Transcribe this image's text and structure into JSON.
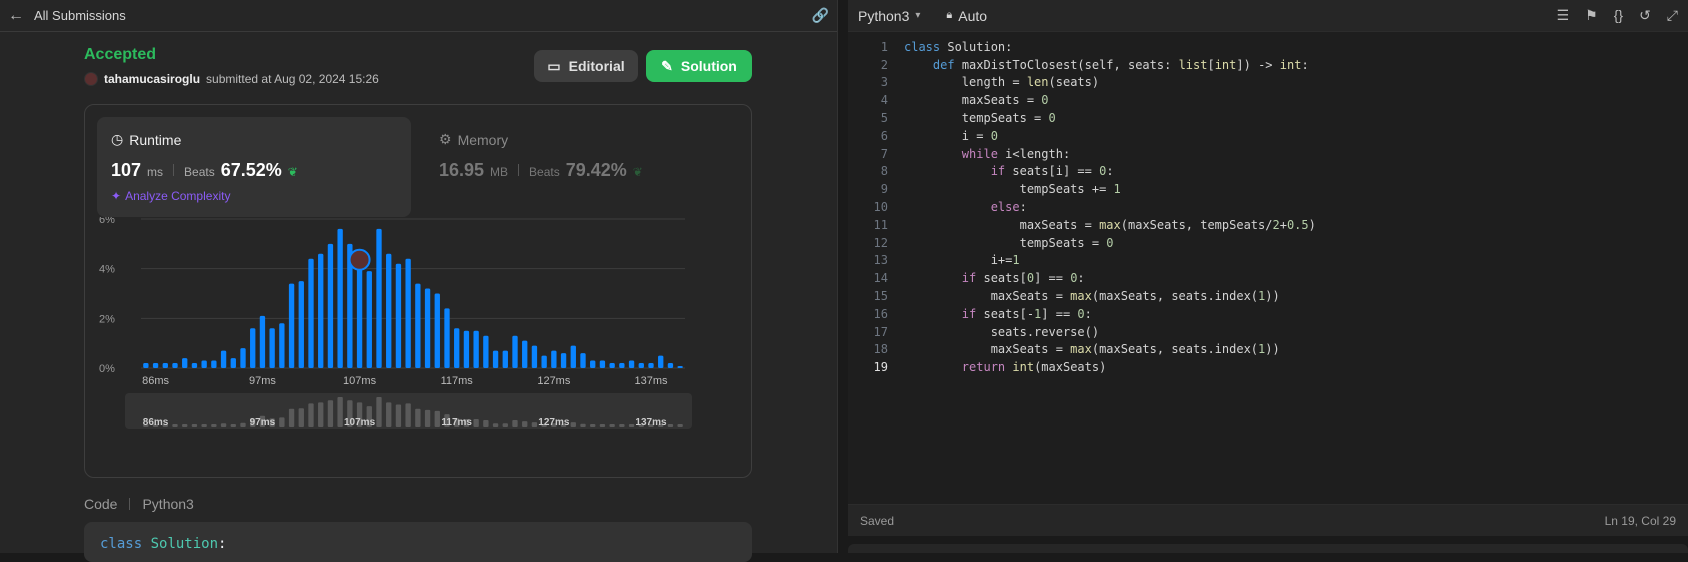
{
  "header": {
    "back_label": "All Submissions"
  },
  "submission": {
    "status": "Accepted",
    "user": "tahamucasiroglu",
    "submitted_text": "submitted at Aug 02, 2024 15:26",
    "editorial_label": "Editorial",
    "solution_label": "Solution"
  },
  "runtime": {
    "title": "Runtime",
    "value": "107",
    "unit": "ms",
    "beats_label": "Beats",
    "beats_pct": "67.52%",
    "analyze_label": "Analyze Complexity"
  },
  "memory": {
    "title": "Memory",
    "value": "16.95",
    "unit": "MB",
    "beats_label": "Beats",
    "beats_pct": "79.42%"
  },
  "chart_data": {
    "type": "bar",
    "ylim": [
      0,
      6
    ],
    "yticks": [
      "6%",
      "4%",
      "2%",
      "0%"
    ],
    "ytick_values": [
      6,
      4,
      2,
      0
    ],
    "xticks": [
      "86ms",
      "97ms",
      "107ms",
      "117ms",
      "127ms",
      "137ms"
    ],
    "xtick_values": [
      86,
      97,
      107,
      117,
      127,
      137
    ],
    "x": [
      85,
      86,
      87,
      88,
      89,
      90,
      91,
      92,
      93,
      94,
      95,
      96,
      97,
      98,
      99,
      100,
      101,
      102,
      103,
      104,
      105,
      106,
      107,
      108,
      109,
      110,
      111,
      112,
      113,
      114,
      115,
      116,
      117,
      118,
      119,
      120,
      121,
      122,
      123,
      124,
      125,
      126,
      127,
      128,
      129,
      130,
      131,
      132,
      133,
      134,
      135,
      136,
      137,
      138,
      139,
      140
    ],
    "values": [
      0.2,
      0.2,
      0.2,
      0.2,
      0.4,
      0.2,
      0.3,
      0.3,
      0.7,
      0.4,
      0.8,
      1.6,
      2.1,
      1.6,
      1.8,
      3.4,
      3.5,
      4.4,
      4.6,
      5.0,
      5.6,
      5.0,
      4.6,
      3.9,
      5.6,
      4.6,
      4.2,
      4.4,
      3.4,
      3.2,
      3.0,
      2.4,
      1.6,
      1.5,
      1.5,
      1.3,
      0.7,
      0.7,
      1.3,
      1.1,
      0.9,
      0.5,
      0.7,
      0.6,
      0.9,
      0.6,
      0.3,
      0.3,
      0.2,
      0.2,
      0.3,
      0.2,
      0.2,
      0.5,
      0.2,
      0.0
    ],
    "highlight_x": 107,
    "grid": true,
    "bar_color": "#0a84ff",
    "overview_color": "#5a5a5a"
  },
  "code_section": {
    "label": "Code",
    "lang": "Python3"
  },
  "preview": {
    "kw": "class",
    "cls": "Solution",
    "rest": ":"
  },
  "editor": {
    "language": "Python3",
    "mode": "Auto",
    "status": "Saved",
    "position": "Ln 19, Col 29",
    "lines": [
      "class Solution:",
      "    def maxDistToClosest(self, seats: list[int]) -> int:",
      "        length = len(seats)",
      "        maxSeats = 0",
      "        tempSeats = 0",
      "        i = 0",
      "        while i<length:",
      "            if seats[i] == 0:",
      "                tempSeats += 1",
      "            else:",
      "                maxSeats = max(maxSeats, tempSeats/2+0.5)",
      "                tempSeats = 0",
      "            i+=1",
      "        if seats[0] == 0:",
      "            maxSeats = max(maxSeats, seats.index(1))",
      "        if seats[-1] == 0:",
      "            seats.reverse()",
      "            maxSeats = max(maxSeats, seats.index(1))",
      "        return int(maxSeats)"
    ],
    "line_numbers": [
      "1",
      "2",
      "3",
      "4",
      "5",
      "6",
      "7",
      "8",
      "9",
      "10",
      "11",
      "12",
      "13",
      "14",
      "15",
      "16",
      "17",
      "18",
      "19"
    ]
  },
  "colors": {
    "accent": "#2cbb5d",
    "bar": "#0a84ff",
    "analyze": "#8b5cf6"
  }
}
